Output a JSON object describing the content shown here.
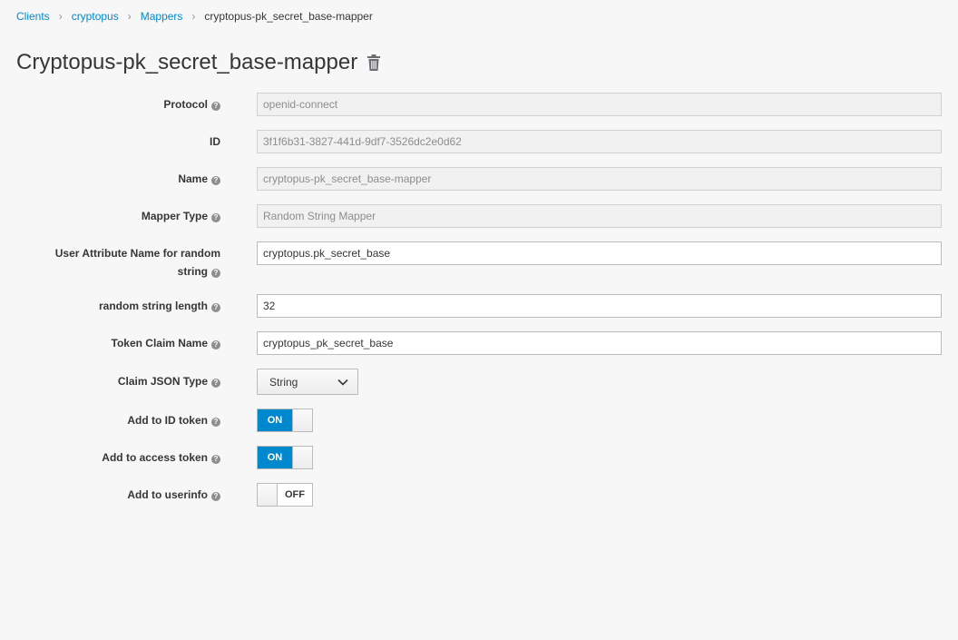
{
  "breadcrumb": {
    "items": [
      "Clients",
      "cryptopus",
      "Mappers"
    ],
    "current": "cryptopus-pk_secret_base-mapper",
    "separator": "›"
  },
  "page": {
    "title": "Cryptopus-pk_secret_base-mapper"
  },
  "help_glyph": "?",
  "form": {
    "protocol": {
      "label": "Protocol",
      "value": "openid-connect"
    },
    "id": {
      "label": "ID",
      "value": "3f1f6b31-3827-441d-9df7-3526dc2e0d62"
    },
    "name": {
      "label": "Name",
      "value": "cryptopus-pk_secret_base-mapper"
    },
    "mapper_type": {
      "label": "Mapper Type",
      "value": "Random String Mapper"
    },
    "user_attribute": {
      "label": "User Attribute Name for random string",
      "value": "cryptopus.pk_secret_base"
    },
    "random_length": {
      "label": "random string length",
      "value": "32"
    },
    "token_claim": {
      "label": "Token Claim Name",
      "value": "cryptopus_pk_secret_base"
    },
    "claim_json_type": {
      "label": "Claim JSON Type",
      "value": "String"
    },
    "add_id_token": {
      "label": "Add to ID token",
      "state": "ON"
    },
    "add_access_token": {
      "label": "Add to access token",
      "state": "ON"
    },
    "add_userinfo": {
      "label": "Add to userinfo",
      "state": "OFF"
    }
  },
  "colors": {
    "accent": "#0088ce",
    "text": "#363636",
    "muted": "#8b8d8f"
  }
}
